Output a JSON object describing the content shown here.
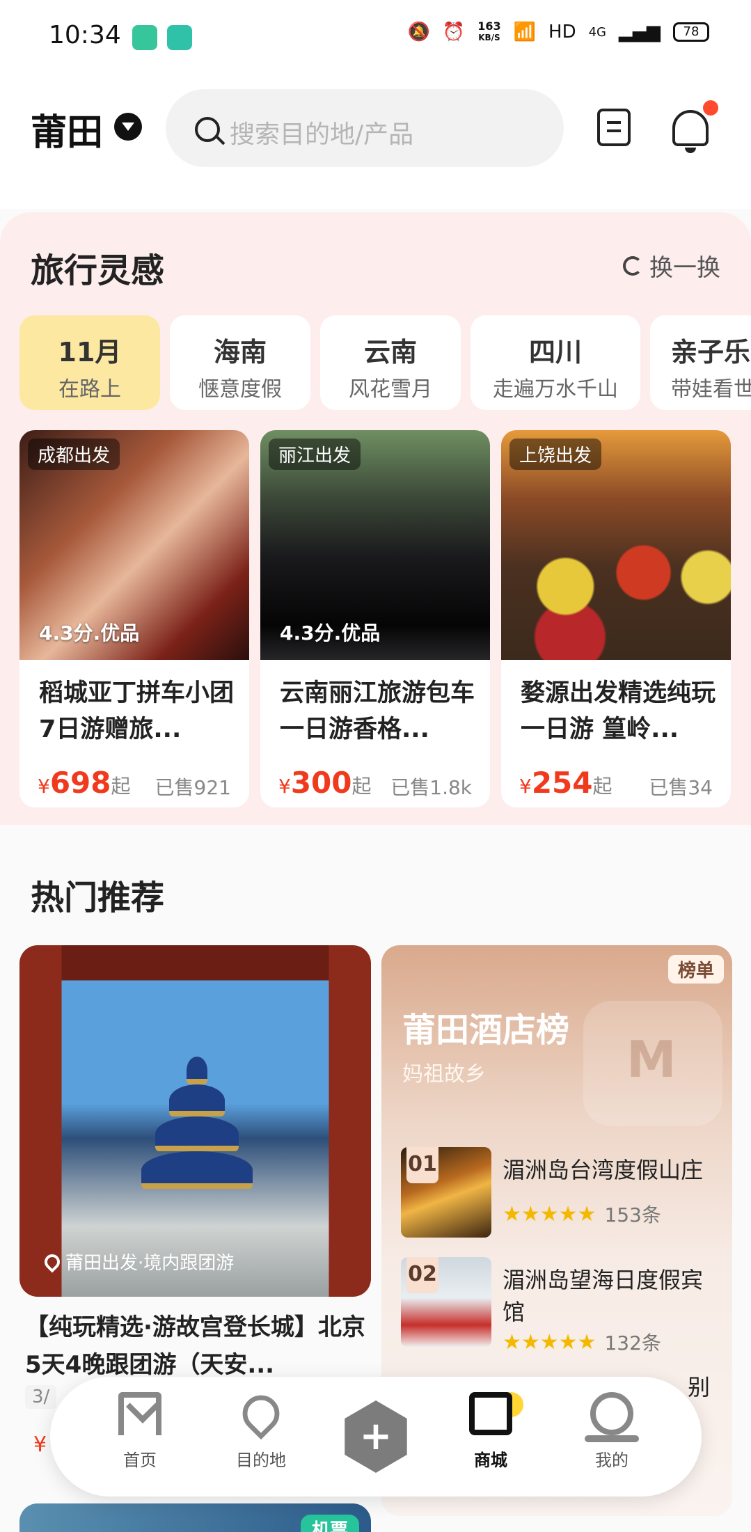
{
  "status_bar": {
    "time": "10:34",
    "speed_value": "163",
    "speed_unit": "KB/S",
    "hd": "HD",
    "network": "4G",
    "battery": "78",
    "icons": [
      "mute-icon",
      "alarm-icon",
      "wifi-icon",
      "signal-icon"
    ]
  },
  "header": {
    "city": "莆田",
    "search_placeholder": "搜索目的地/产品",
    "notification_dot_color": "#ff4a2e"
  },
  "inspiration": {
    "title": "旅行灵感",
    "refresh_label": "换一换",
    "tabs": [
      {
        "main": "11月",
        "sub": "在路上"
      },
      {
        "main": "海南",
        "sub": "惬意度假"
      },
      {
        "main": "云南",
        "sub": "风花雪月"
      },
      {
        "main": "四川",
        "sub": "走遍万水千山"
      },
      {
        "main": "亲子乐",
        "sub": "带娃看世"
      }
    ],
    "cards": [
      {
        "depart": "成都出发",
        "score": "4.3分.优品",
        "title": "稻城亚丁拼车小团7日游赠旅...",
        "currency": "¥",
        "price": "698",
        "qi": "起",
        "sold": "已售921"
      },
      {
        "depart": "丽江出发",
        "score": "4.3分.优品",
        "title": "云南丽江旅游包车一日游香格...",
        "currency": "¥",
        "price": "300",
        "qi": "起",
        "sold": "已售1.8k"
      },
      {
        "depart": "上饶出发",
        "score": "",
        "title": "婺源出发精选纯玩一日游 篁岭...",
        "currency": "¥",
        "price": "254",
        "qi": "起",
        "sold": "已售34"
      }
    ]
  },
  "hot": {
    "title": "热门推荐",
    "feature": {
      "tag": "莆田出发·境内跟团游",
      "name": "【纯玩精选·游故宫登长城】北京5天4晚跟团游（天安...",
      "chip": "3/",
      "price_prefix": "¥"
    },
    "second_badge": "机票",
    "ranking": {
      "badge": "榜单",
      "title": "莆田酒店榜",
      "subtitle": "妈祖故乡",
      "items": [
        {
          "no": "01",
          "name": "湄洲岛台湾度假山庄",
          "stars": "★★★★★",
          "count": "153条"
        },
        {
          "no": "02",
          "name": "湄洲岛望海日度假宾馆",
          "stars": "★★★★★",
          "count": "132条"
        }
      ],
      "peek_text": "别"
    }
  },
  "nav": {
    "items": [
      {
        "label": "首页"
      },
      {
        "label": "目的地"
      },
      {
        "label": "商城"
      },
      {
        "label": "我的"
      }
    ],
    "fab": "+"
  }
}
